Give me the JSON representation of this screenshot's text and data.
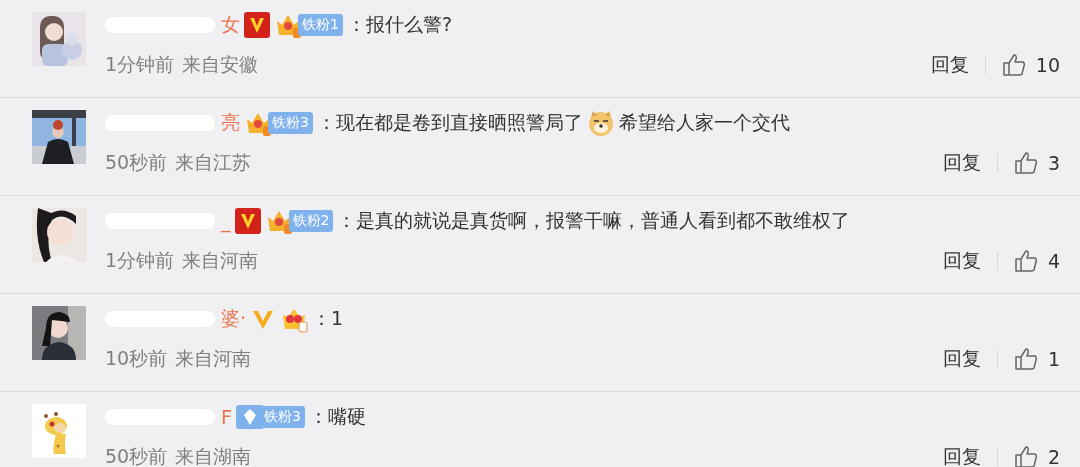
{
  "comments": [
    {
      "avatar": {
        "kind": "picture"
      },
      "name_visible": "女",
      "verified": {
        "kind": "red"
      },
      "crown": {
        "kind": "crown"
      },
      "fan_badge": "铁粉1",
      "text_parts": [
        "：报什么警?"
      ],
      "time": "1分钟前",
      "location": "来自安徽",
      "reply": "回复",
      "likes": "10"
    },
    {
      "avatar": {
        "kind": "picture"
      },
      "name_visible": "亮",
      "crown": {
        "kind": "crown"
      },
      "fan_badge": "铁粉3",
      "text_parts": [
        "：现在都是卷到直接晒照警局了",
        "希望给人家一个交代"
      ],
      "time": "50秒前",
      "location": "来自江苏",
      "reply": "回复",
      "likes": "3"
    },
    {
      "avatar": {
        "kind": "picture"
      },
      "name_visible": "_",
      "verified": {
        "kind": "red"
      },
      "crown": {
        "kind": "crown"
      },
      "fan_badge": "铁粉2",
      "text_parts": [
        "：是真的就说是真货啊，报警干嘛，普通人看到都不敢维权了"
      ],
      "time": "1分钟前",
      "location": "来自河南",
      "reply": "回复",
      "likes": "4"
    },
    {
      "avatar": {
        "kind": "picture"
      },
      "name_visible": "婆·",
      "verified": {
        "kind": "yellow"
      },
      "crown": {
        "kind": "heart-crown"
      },
      "text_parts": [
        "：1"
      ],
      "time": "10秒前",
      "location": "来自河南",
      "reply": "回复",
      "likes": "1"
    },
    {
      "avatar": {
        "kind": "picture"
      },
      "name_visible": "F",
      "crown": {
        "kind": "diamond"
      },
      "fan_badge": "铁粉3",
      "text_parts": [
        "：嘴硬"
      ],
      "time": "50秒前",
      "location": "来自湖南",
      "reply": "回复",
      "likes": "2"
    }
  ]
}
